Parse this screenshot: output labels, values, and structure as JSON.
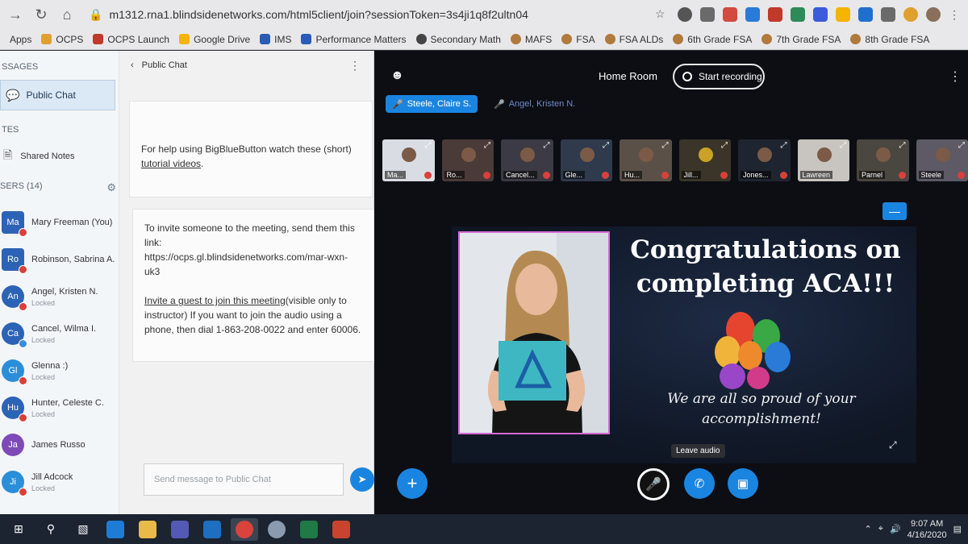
{
  "browser": {
    "url": "m1312.rna1.blindsidenetworks.com/html5client/join?sessionToken=3s4ji1q8f2ultn04",
    "bookmarks": [
      "Apps",
      "OCPS",
      "OCPS Launch",
      "Google Drive",
      "IMS",
      "Performance Matters",
      "Secondary Math",
      "MAFS",
      "FSA",
      "FSA ALDs",
      "6th Grade FSA",
      "7th Grade FSA",
      "8th Grade FSA"
    ]
  },
  "sidebar": {
    "messages_title": "SSAGES",
    "public_chat": "Public Chat",
    "notes_title": "TES",
    "shared_notes": "Shared Notes",
    "users_title": "SERS (14)",
    "users": [
      {
        "initials": "Ma",
        "name": "Mary Freeman (You)",
        "status": "",
        "color": "#2c63b6"
      },
      {
        "initials": "Ro",
        "name": "Robinson, Sabrina A.",
        "status": "",
        "color": "#2c63b6"
      },
      {
        "initials": "An",
        "name": "Angel, Kristen N.",
        "status": "Locked",
        "color": "#2c63b6"
      },
      {
        "initials": "Ca",
        "name": "Cancel, Wilma I.",
        "status": "Locked",
        "color": "#2c63b6"
      },
      {
        "initials": "Gl",
        "name": "Glenna :)",
        "status": "Locked",
        "color": "#2a8ed8"
      },
      {
        "initials": "Hu",
        "name": "Hunter, Celeste C.",
        "status": "Locked",
        "color": "#2c63b6"
      },
      {
        "initials": "Ja",
        "name": "James Russo",
        "status": "",
        "color": "#7d4ab8"
      },
      {
        "initials": "Ji",
        "name": "Jill Adcock",
        "status": "Locked",
        "color": "#2a8ed8"
      }
    ]
  },
  "chat": {
    "title": "Public Chat",
    "welcome_pre": "For help using BigBlueButton watch these (short)",
    "welcome_link": "tutorial videos",
    "welcome_post": ".",
    "invite_line1": "To invite someone to the meeting, send them this link:",
    "invite_link": "https://ocps.gl.blindsidenetworks.com/mar-wxn-uk3",
    "invite_guest": "Invite a guest to join this meeting",
    "invite_rest": "(visible only to instructor) If you want to join the audio using a phone, then dial 1-863-208-0022 and enter 60006.",
    "input_placeholder": "Send message to Public Chat"
  },
  "meeting": {
    "room_title": "Home Room",
    "record_label": "Start recording",
    "talkers": [
      "Steele, Claire S.",
      "Angel, Kristen N."
    ],
    "video_tiles": [
      "Ma...",
      "Ro...",
      "Cancel...",
      "Gle...",
      "Hu...",
      "Jill...",
      "Jones...",
      "Lawreen",
      "Parnel",
      "Steele"
    ],
    "slide_heading": "Congratulations on completing ACA!!!",
    "slide_message": "We are all so proud of your accomplishment!",
    "tooltip": "Leave audio"
  },
  "taskbar": {
    "time": "9:07 AM",
    "date": "4/16/2020"
  }
}
